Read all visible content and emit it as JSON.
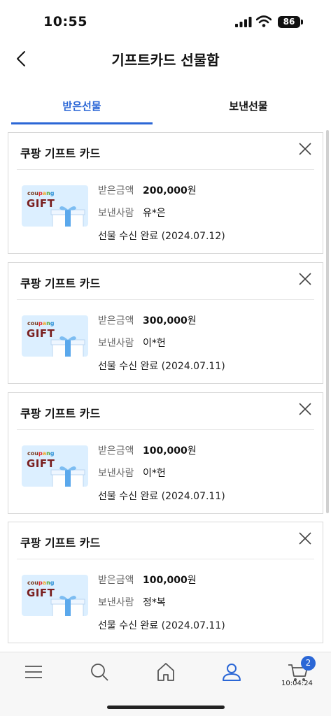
{
  "status_bar": {
    "time": "10:55",
    "battery": "86"
  },
  "header": {
    "title": "기프트카드 선물함"
  },
  "tabs": [
    {
      "label": "받은선물"
    },
    {
      "label": "보낸선물"
    }
  ],
  "gift_image": {
    "brand": [
      "cou",
      "p",
      "a",
      "n",
      "g"
    ],
    "word": "GIFT"
  },
  "labels": {
    "amount": "받은금액",
    "sender": "보낸사람"
  },
  "cards": [
    {
      "title": "쿠팡 기프트 카드",
      "amount": "200,000",
      "unit": "원",
      "sender": "유*은",
      "status": "선물 수신 완료 (2024.07.12)"
    },
    {
      "title": "쿠팡 기프트 카드",
      "amount": "300,000",
      "unit": "원",
      "sender": "이*헌",
      "status": "선물 수신 완료 (2024.07.11)"
    },
    {
      "title": "쿠팡 기프트 카드",
      "amount": "100,000",
      "unit": "원",
      "sender": "이*헌",
      "status": "선물 수신 완료 (2024.07.11)"
    },
    {
      "title": "쿠팡 기프트 카드",
      "amount": "100,000",
      "unit": "원",
      "sender": "정*복",
      "status": "선물 수신 완료 (2024.07.11)"
    }
  ],
  "bottom_nav": {
    "items": [
      "menu-icon",
      "search-icon",
      "home-icon",
      "profile-icon",
      "cart-icon"
    ],
    "cart_badge": "2",
    "cart_time": "10:04:24"
  },
  "colors": {
    "accent": "#2b67d6"
  }
}
